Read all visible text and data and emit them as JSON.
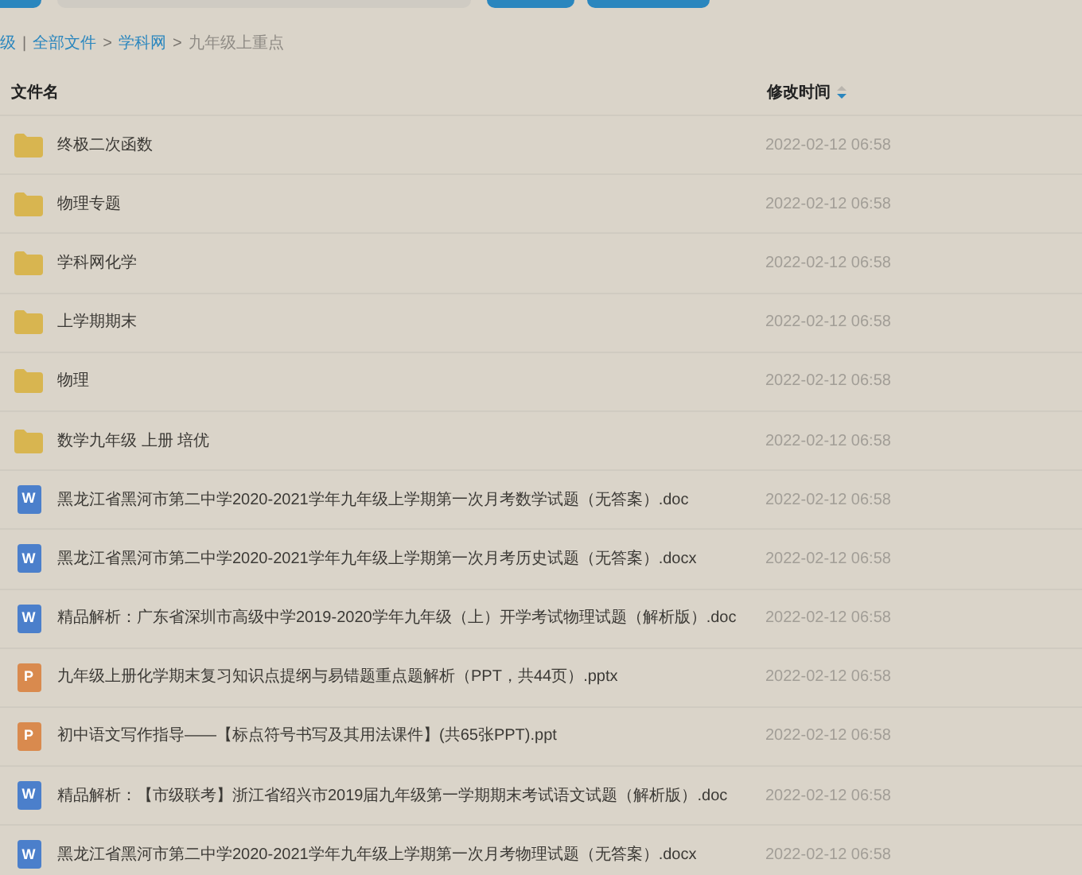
{
  "breadcrumb": [
    {
      "text": "级",
      "kind": "link"
    },
    {
      "text": "|",
      "kind": "sep"
    },
    {
      "text": "全部文件",
      "kind": "link"
    },
    {
      "text": ">",
      "kind": "sep"
    },
    {
      "text": "学科网",
      "kind": "link"
    },
    {
      "text": ">",
      "kind": "sep"
    },
    {
      "text": "九年级上重点",
      "kind": "current"
    }
  ],
  "table": {
    "columns": [
      {
        "label": "文件名"
      },
      {
        "label": "修改时间",
        "sort_descending": true
      }
    ],
    "rows": [
      {
        "kind": "folder",
        "name": "终极二次函数",
        "modified": "2022-02-12 06:58"
      },
      {
        "kind": "folder",
        "name": "物理专题",
        "modified": "2022-02-12 06:58"
      },
      {
        "kind": "folder",
        "name": "学科网化学",
        "modified": "2022-02-12 06:58"
      },
      {
        "kind": "folder",
        "name": "上学期期末",
        "modified": "2022-02-12 06:58"
      },
      {
        "kind": "folder",
        "name": "物理",
        "modified": "2022-02-12 06:58"
      },
      {
        "kind": "folder",
        "name": "数学九年级 上册 培优",
        "modified": "2022-02-12 06:58"
      },
      {
        "kind": "word",
        "icon_text": "W",
        "name": "黑龙江省黑河市第二中学2020-2021学年九年级上学期第一次月考数学试题（无答案）.doc",
        "modified": "2022-02-12 06:58"
      },
      {
        "kind": "word",
        "icon_text": "W",
        "name": "黑龙江省黑河市第二中学2020-2021学年九年级上学期第一次月考历史试题（无答案）.docx",
        "modified": "2022-02-12 06:58"
      },
      {
        "kind": "word",
        "icon_text": "W",
        "name": "精品解析：广东省深圳市高级中学2019-2020学年九年级（上）开学考试物理试题（解析版）.doc",
        "modified": "2022-02-12 06:58"
      },
      {
        "kind": "ppt",
        "icon_text": "P",
        "name": "九年级上册化学期末复习知识点提纲与易错题重点题解析（PPT，共44页）.pptx",
        "modified": "2022-02-12 06:58"
      },
      {
        "kind": "ppt",
        "icon_text": "P",
        "name": "初中语文写作指导——【标点符号书写及其用法课件】(共65张PPT).ppt",
        "modified": "2022-02-12 06:58"
      },
      {
        "kind": "word",
        "icon_text": "W",
        "name": "精品解析：【市级联考】浙江省绍兴市2019届九年级第一学期期末考试语文试题（解析版）.doc",
        "modified": "2022-02-12 06:58"
      },
      {
        "kind": "word",
        "icon_text": "W",
        "name": "黑龙江省黑河市第二中学2020-2021学年九年级上学期第一次月考物理试题（无答案）.docx",
        "modified": "2022-02-12 06:58"
      }
    ]
  }
}
